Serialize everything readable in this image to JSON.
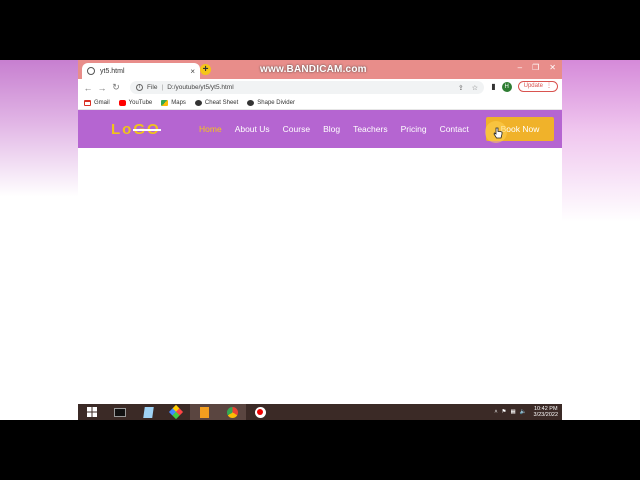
{
  "watermark": "www.BANDICAM.com",
  "browser": {
    "tab_title": "yt5.html",
    "tab_close": "×",
    "new_tab": "+",
    "window_controls": [
      "–",
      "❐",
      "✕"
    ],
    "omnibox": {
      "scheme_label": "File",
      "url": "D:/youtube/yt5/yt5.html"
    },
    "profile_initial": "H",
    "update_label": "Update",
    "bookmarks": [
      {
        "label": "Gmail",
        "icon": "gmail-icon",
        "color": "#d93025"
      },
      {
        "label": "YouTube",
        "icon": "youtube-icon",
        "color": "#ff0000"
      },
      {
        "label": "Maps",
        "icon": "maps-icon",
        "color": "#34a853"
      },
      {
        "label": "Cheat Sheet",
        "icon": "globe-icon",
        "color": "#333333"
      },
      {
        "label": "Shape Divider",
        "icon": "globe-icon",
        "color": "#333333"
      }
    ]
  },
  "site": {
    "logo": {
      "part1": "Lo",
      "part2": "GO"
    },
    "menu": [
      "Home",
      "About Us",
      "Course",
      "Blog",
      "Teachers",
      "Pricing",
      "Contact"
    ],
    "book_label": "Book Now",
    "colors": {
      "navbar": "#b565d1",
      "accent": "#f5c518",
      "button": "#f0b22a"
    }
  },
  "taskbar": {
    "time": "10:42 PM",
    "date": "3/23/2022"
  }
}
